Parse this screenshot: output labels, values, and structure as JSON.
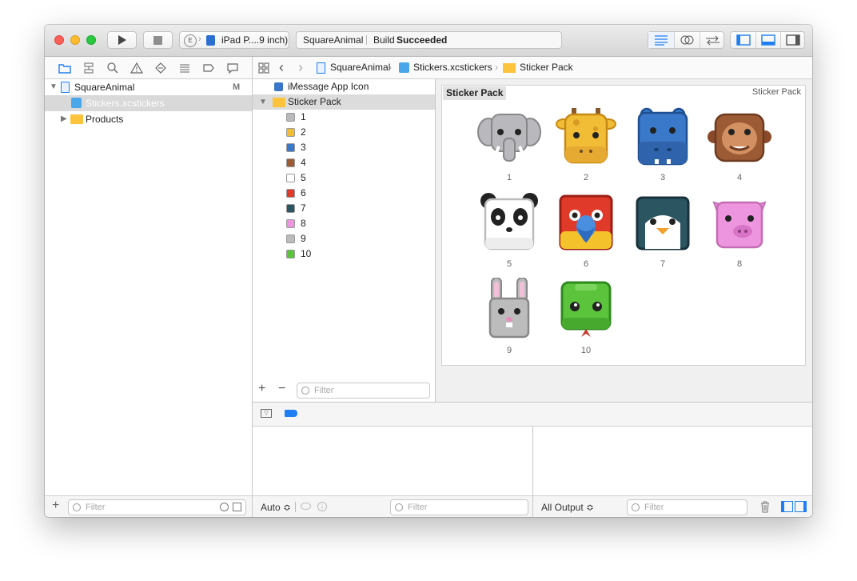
{
  "toolbar": {
    "scheme_badge": "E",
    "device_label": "iPad P....9 inch)",
    "status_project": "SquareAnimal",
    "status_prefix": "Build",
    "status_result": "Succeeded"
  },
  "navigator": {
    "project_name": "SquareAnimal",
    "project_badge": "M",
    "selected_file": "Stickers.xcstickers",
    "products_label": "Products",
    "filter_placeholder": "Filter"
  },
  "jump_bar": {
    "crumbs": [
      "SquareAnimal",
      "Stickers.xcstickers",
      "Sticker Pack"
    ]
  },
  "outline": {
    "app_icon_label": "iMessage App Icon",
    "pack_label": "Sticker Pack",
    "stickers": [
      "1",
      "2",
      "3",
      "4",
      "5",
      "6",
      "7",
      "8",
      "9",
      "10"
    ],
    "filter_placeholder": "Filter"
  },
  "canvas": {
    "pack_title": "Sticker Pack",
    "pack_corner_label": "Sticker Pack",
    "stickers": [
      {
        "label": "1",
        "animal": "elephant-icon",
        "color": "#b8b8bd"
      },
      {
        "label": "2",
        "animal": "giraffe-icon",
        "color": "#f2bd36"
      },
      {
        "label": "3",
        "animal": "hippo-icon",
        "color": "#3a78c9"
      },
      {
        "label": "4",
        "animal": "monkey-icon",
        "color": "#9c5a35"
      },
      {
        "label": "5",
        "animal": "panda-icon",
        "color": "#ffffff"
      },
      {
        "label": "6",
        "animal": "parrot-icon",
        "color": "#e03a2a"
      },
      {
        "label": "7",
        "animal": "penguin-icon",
        "color": "#2c5562"
      },
      {
        "label": "8",
        "animal": "pig-icon",
        "color": "#ee95df"
      },
      {
        "label": "9",
        "animal": "rabbit-icon",
        "color": "#bcbcbc"
      },
      {
        "label": "10",
        "animal": "snake-icon",
        "color": "#5bc43c"
      }
    ]
  },
  "debug": {
    "auto_label": "Auto ≎",
    "filter_placeholder": "Filter",
    "all_output_label": "All Output ≎",
    "filter_placeholder_right": "Filter"
  },
  "colors": {
    "accent": "#1f7ff2",
    "selection": "#d9d9d9"
  }
}
